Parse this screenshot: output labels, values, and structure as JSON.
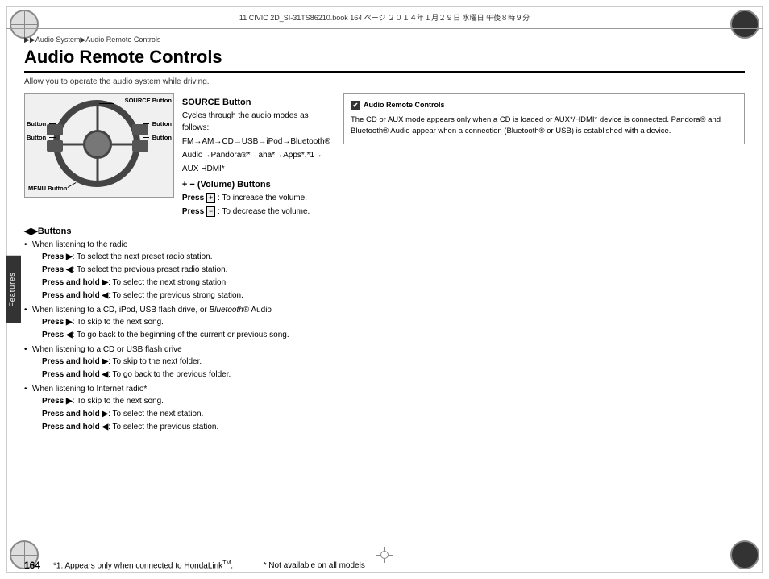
{
  "header": {
    "book_info": "11 CIVIC 2D_SI-31TS86210.book   164 ページ   ２０１４年１月２９日   水曜日   午後８時９分"
  },
  "breadcrumb": {
    "text": "▶▶Audio System▶Audio Remote Controls"
  },
  "page_title": "Audio Remote Controls",
  "subtitle": "Allow you to operate the audio system while driving.",
  "image_labels": {
    "source_button": "SOURCE Button",
    "button_left1": "Button",
    "button_left2": "Button",
    "button_right1": "Button",
    "button_right2": "Button",
    "menu_button": "MENU Button"
  },
  "source_section": {
    "title": "SOURCE Button",
    "body": "Cycles through the audio modes as follows:",
    "cycle": "FM→AM→CD→USB→iPod→Bluetooth®",
    "cycle2": "Audio→Pandora®*→aha*→Apps*,*1→",
    "cycle3": "AUX HDMI*"
  },
  "volume_section": {
    "title": "+ − (Volume) Buttons",
    "press_plus": "Press",
    "plus_icon": "+",
    "press_plus_desc": ": To increase the volume.",
    "press_minus": "Press",
    "minus_icon": "−",
    "press_minus_desc": ": To decrease the volume."
  },
  "prev_next_section": {
    "title": "◀▶Buttons",
    "items": [
      {
        "intro": "When listening to the radio",
        "subitems": [
          "Press ▶: To select the next preset radio station.",
          "Press ◀: To select the previous preset radio station.",
          "Press and hold ▶: To select the next strong station.",
          "Press and hold ◀: To select the previous strong station."
        ]
      },
      {
        "intro": "When listening to a CD, iPod, USB flash drive, or Bluetooth® Audio",
        "subitems": [
          "Press ▶: To skip to the next song.",
          "Press ◀: To go back to the beginning of the current or previous song."
        ]
      },
      {
        "intro": "When listening to a CD or USB flash drive",
        "subitems": [
          "Press and hold ▶: To skip to the next folder.",
          "Press and hold ◀: To go back to the previous folder."
        ]
      },
      {
        "intro": "When listening to Internet radio*",
        "subitems": [
          "Press ▶: To skip to the next song.",
          "Press and hold ▶: To select the next station.",
          "Press and hold ◀: To select the previous station."
        ]
      }
    ]
  },
  "footnotes": {
    "star1": "*1: Appears only when connected to HondaLink",
    "tm": "TM",
    "star": "* Not available on all models"
  },
  "note_box": {
    "header": "Audio Remote Controls",
    "body": "The CD or AUX mode appears only when a CD is loaded or AUX*/HDMI* device is connected. Pandora® and Bluetooth® Audio appear when a connection (Bluetooth® or USB) is established with a device."
  },
  "features_tab": "Features",
  "page_number": "164"
}
